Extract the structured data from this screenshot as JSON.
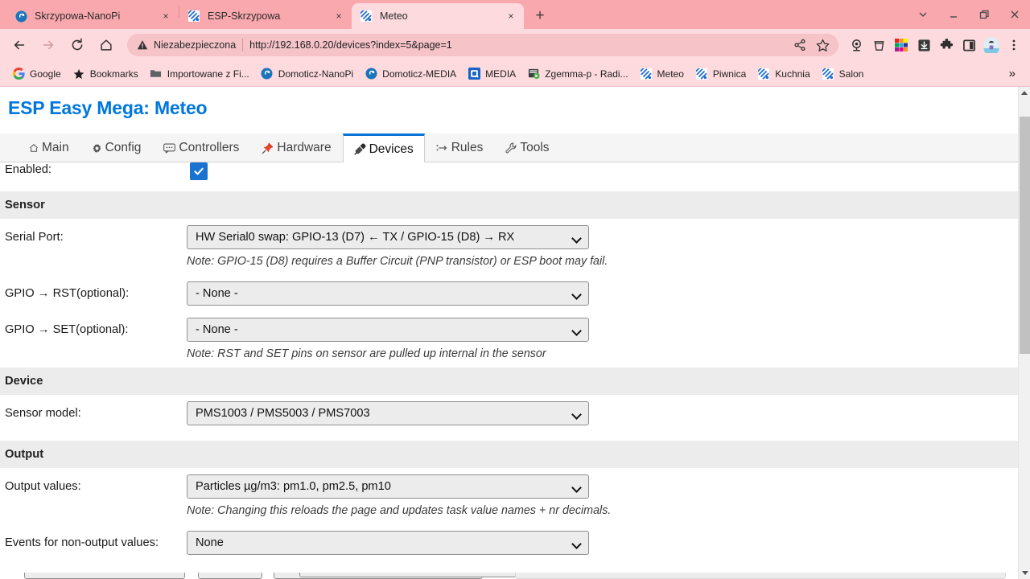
{
  "browser": {
    "tabs": [
      {
        "title": "Skrzypowa-NanoPi",
        "favicon": "domoticz-icon",
        "active": false
      },
      {
        "title": "ESP-Skrzypowa",
        "favicon": "espeasy-icon",
        "active": false
      },
      {
        "title": "Meteo",
        "favicon": "espeasy-icon",
        "active": true
      }
    ],
    "new_tab_label": "+",
    "close_label": "×",
    "window_controls": {
      "tab_search": "⌄",
      "minimize": "—",
      "maximize": "❐",
      "close": "✕"
    },
    "toolbar": {
      "back": "←",
      "forward": "→",
      "reload": "⟳",
      "home": "⌂",
      "security_label": "Niezabezpieczona",
      "url": "http://192.168.0.20/devices?index=5&page=1",
      "share": "share-icon",
      "bookmark_star": "☆",
      "extensions": [
        "webcam-icon",
        "bucket-icon",
        "color-grid-icon",
        "download-icon",
        "puzzle-icon",
        "sidepanel-icon"
      ],
      "profile": "avatar-icon",
      "menu": "⋮"
    },
    "bookmarks": [
      {
        "label": "Google",
        "icon": "google-icon"
      },
      {
        "label": "Bookmarks",
        "icon": "star-icon"
      },
      {
        "label": "Importowane z Fi...",
        "icon": "folder-icon"
      },
      {
        "label": "Domoticz-NanoPi",
        "icon": "domoticz-icon"
      },
      {
        "label": "Domoticz-MEDIA",
        "icon": "domoticz-icon"
      },
      {
        "label": "MEDIA",
        "icon": "media-icon"
      },
      {
        "label": "Zgemma-p - Radi...",
        "icon": "zgemma-icon"
      },
      {
        "label": "Meteo",
        "icon": "espeasy-icon"
      },
      {
        "label": "Piwnica",
        "icon": "espeasy-icon"
      },
      {
        "label": "Kuchnia",
        "icon": "espeasy-icon"
      },
      {
        "label": "Salon",
        "icon": "espeasy-icon"
      }
    ],
    "bookmarks_overflow": "»"
  },
  "page": {
    "title": "ESP Easy Mega: Meteo",
    "nav": [
      {
        "label": "Main",
        "icon": "home-icon",
        "active": false
      },
      {
        "label": "Config",
        "icon": "gear-icon",
        "active": false
      },
      {
        "label": "Controllers",
        "icon": "chat-icon",
        "active": false
      },
      {
        "label": "Hardware",
        "icon": "pin-icon",
        "active": false
      },
      {
        "label": "Devices",
        "icon": "plug-icon",
        "active": true
      },
      {
        "label": "Rules",
        "icon": "arrow-icon",
        "active": false
      },
      {
        "label": "Tools",
        "icon": "wrench-icon",
        "active": false
      }
    ],
    "form": {
      "enabled": {
        "label": "Enabled:",
        "checked": true
      },
      "sections": [
        {
          "heading": "Sensor",
          "fields": [
            {
              "label": "Serial Port:",
              "value": "HW Serial0 swap: GPIO-13 (D7) ← TX / GPIO-15 (D8) → RX",
              "note": "Note: GPIO-15 (D8) requires a Buffer Circuit (PNP transistor) or ESP boot may fail."
            },
            {
              "label": "GPIO → RST(optional):",
              "value": "- None -",
              "note": ""
            },
            {
              "label": "GPIO → SET(optional):",
              "value": "- None -",
              "note": "Note: RST and SET pins on sensor are pulled up internal in the sensor"
            }
          ]
        },
        {
          "heading": "Device",
          "fields": [
            {
              "label": "Sensor model:",
              "value": "PMS1003 / PMS5003 / PMS7003",
              "note": ""
            }
          ]
        },
        {
          "heading": "Output",
          "fields": [
            {
              "label": "Output values:",
              "value": "Particles µg/m3: pm1.0, pm2.5, pm10",
              "note": "Note: Changing this reloads the page and updates task value names + nr decimals."
            },
            {
              "label": "Events for non-output values:",
              "value": "None",
              "note": ""
            }
          ]
        }
      ]
    }
  },
  "colors": {
    "chrome_frame": "#f9a8ae",
    "chrome_toolbar": "#fddadd",
    "page_title": "#0077dd",
    "active_tab_border": "#0a73d6",
    "checkbox": "#1a73d1",
    "section_bg": "#ececec"
  }
}
